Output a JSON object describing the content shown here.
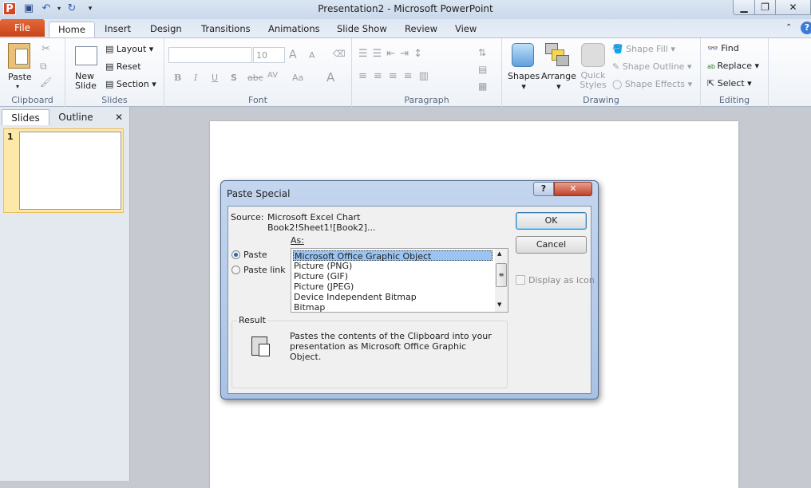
{
  "titlebar": {
    "title": "Presentation2  -  Microsoft PowerPoint",
    "app_icon": "P"
  },
  "tabs": {
    "file": "File",
    "items": [
      "Home",
      "Insert",
      "Design",
      "Transitions",
      "Animations",
      "Slide Show",
      "Review",
      "View"
    ]
  },
  "ribbon": {
    "clipboard": {
      "label": "Clipboard",
      "paste": "Paste"
    },
    "slides": {
      "label": "Slides",
      "new_slide": "New Slide",
      "layout": "Layout",
      "reset": "Reset",
      "section": "Section"
    },
    "font": {
      "label": "Font",
      "font_name": "",
      "font_size": "10",
      "bold": "B",
      "italic": "I",
      "underline": "U",
      "shadow": "S",
      "strike": "abc",
      "spacing": "AV",
      "case": "Aa",
      "grow": "A",
      "shrink": "A",
      "color": "A"
    },
    "paragraph": {
      "label": "Paragraph"
    },
    "drawing": {
      "label": "Drawing",
      "shapes": "Shapes",
      "arrange": "Arrange",
      "quick_styles": "Quick Styles",
      "shape_fill": "Shape Fill",
      "shape_outline": "Shape Outline",
      "shape_effects": "Shape Effects"
    },
    "editing": {
      "label": "Editing",
      "find": "Find",
      "replace": "Replace",
      "select": "Select"
    }
  },
  "leftpane": {
    "tabs": [
      "Slides",
      "Outline"
    ],
    "slide_number": "1"
  },
  "dialog": {
    "title": "Paste Special",
    "help": "?",
    "source_label": "Source:",
    "source_line1": "Microsoft Excel Chart",
    "source_line2": "Book2!Sheet1![Book2]...",
    "as_label": "As:",
    "paste": "Paste",
    "paste_link": "Paste link",
    "options": [
      "Microsoft Office Graphic Object",
      "Picture (PNG)",
      "Picture (GIF)",
      "Picture (JPEG)",
      "Device Independent Bitmap",
      "Bitmap"
    ],
    "ok": "OK",
    "cancel": "Cancel",
    "display_as_icon": "Display as icon",
    "result_label": "Result",
    "result_text": "Pastes the contents of the Clipboard into your presentation as Microsoft Office Graphic Object."
  }
}
